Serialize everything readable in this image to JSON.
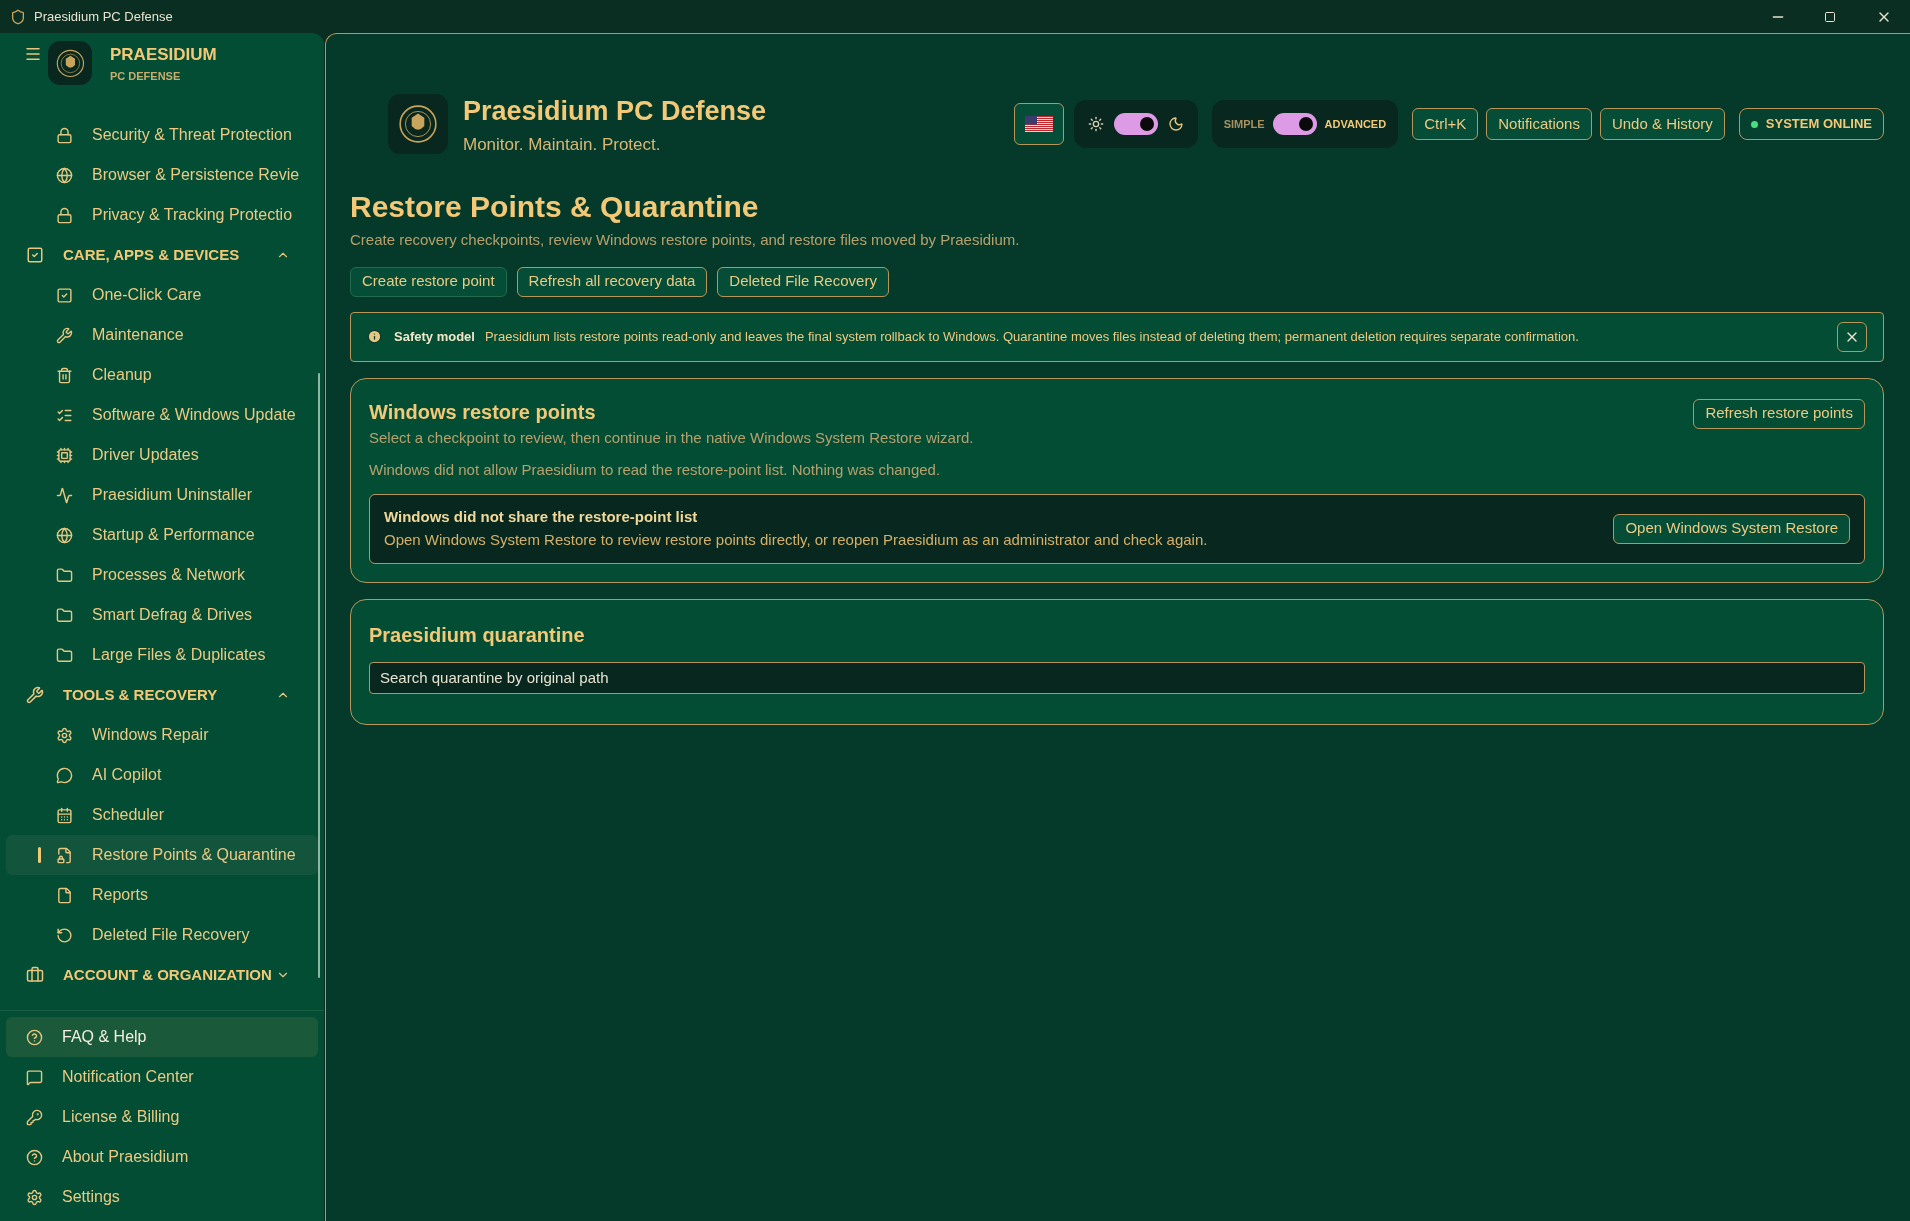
{
  "window": {
    "title": "Praesidium PC Defense"
  },
  "sidebar": {
    "brand": {
      "name": "PRAESIDIUM",
      "subtitle": "PC DEFENSE"
    },
    "sections": [
      {
        "children": [
          {
            "label": "Security & Threat Protection",
            "selected": false
          },
          {
            "label": "Browser & Persistence Revie",
            "selected": false
          },
          {
            "label": "Privacy & Tracking Protectio",
            "selected": false
          }
        ]
      },
      {
        "title": "CARE, APPS & DEVICES",
        "expanded": true,
        "children": [
          {
            "label": "One-Click Care",
            "selected": false
          },
          {
            "label": "Maintenance",
            "selected": false
          },
          {
            "label": "Cleanup",
            "selected": false
          },
          {
            "label": "Software & Windows Update",
            "selected": false
          },
          {
            "label": "Driver Updates",
            "selected": false
          },
          {
            "label": "Praesidium Uninstaller",
            "selected": false
          },
          {
            "label": "Startup & Performance",
            "selected": false
          },
          {
            "label": "Processes & Network",
            "selected": false
          },
          {
            "label": "Smart Defrag & Drives",
            "selected": false
          },
          {
            "label": "Large Files & Duplicates",
            "selected": false
          }
        ]
      },
      {
        "title": "TOOLS & RECOVERY",
        "expanded": true,
        "children": [
          {
            "label": "Windows Repair",
            "selected": false
          },
          {
            "label": "AI Copilot",
            "selected": false
          },
          {
            "label": "Scheduler",
            "selected": false
          },
          {
            "label": "Restore Points & Quarantine",
            "selected": true
          },
          {
            "label": "Reports",
            "selected": false
          },
          {
            "label": "Deleted File Recovery",
            "selected": false
          }
        ]
      },
      {
        "title": "ACCOUNT & ORGANIZATION",
        "expanded": false
      }
    ],
    "footer_items": [
      {
        "label": "FAQ & Help",
        "selected": true
      },
      {
        "label": "Notification Center",
        "selected": false
      },
      {
        "label": "License & Billing",
        "selected": false
      },
      {
        "label": "About Praesidium",
        "selected": false
      },
      {
        "label": "Settings",
        "selected": false
      }
    ]
  },
  "header": {
    "title": "Praesidium PC Defense",
    "tagline": "Monitor. Maintain. Protect.",
    "dark_mode": {
      "on": true
    },
    "mode_toggle": {
      "left": "SIMPLE",
      "right": "ADVANCED",
      "on": true
    },
    "buttons": [
      "Ctrl+K",
      "Notifications",
      "Undo & History"
    ],
    "status": {
      "label": "SYSTEM ONLINE",
      "color": "#4ade80"
    }
  },
  "page": {
    "title": "Restore Points & Quarantine",
    "description": "Create recovery checkpoints, review Windows restore points, and restore files moved by Praesidium.",
    "actions": [
      {
        "label": "Create restore point",
        "kind": "plain"
      },
      {
        "label": "Refresh all recovery data",
        "kind": "outline"
      },
      {
        "label": "Deleted File Recovery",
        "kind": "outline"
      }
    ],
    "alert": {
      "label": "Safety model",
      "text": "Praesidium lists restore points read-only and leaves the final system rollback to Windows. Quarantine moves files instead of deleting them; permanent deletion requires separate confirmation."
    },
    "restore_card": {
      "title": "Windows restore points",
      "subtitle": "Select a checkpoint to review, then continue in the native Windows System Restore wizard.",
      "message": "Windows did not allow Praesidium to read the restore-point list. Nothing was changed.",
      "button": "Refresh restore points",
      "notice": {
        "title": "Windows did not share the restore-point list",
        "text": "Open Windows System Restore to review restore points directly, or reopen Praesidium as an administrator and check again.",
        "button": "Open Windows System Restore"
      }
    },
    "quarantine_card": {
      "title": "Praesidium quarantine",
      "search": {
        "placeholder": "Search quarantine by original path"
      }
    }
  }
}
